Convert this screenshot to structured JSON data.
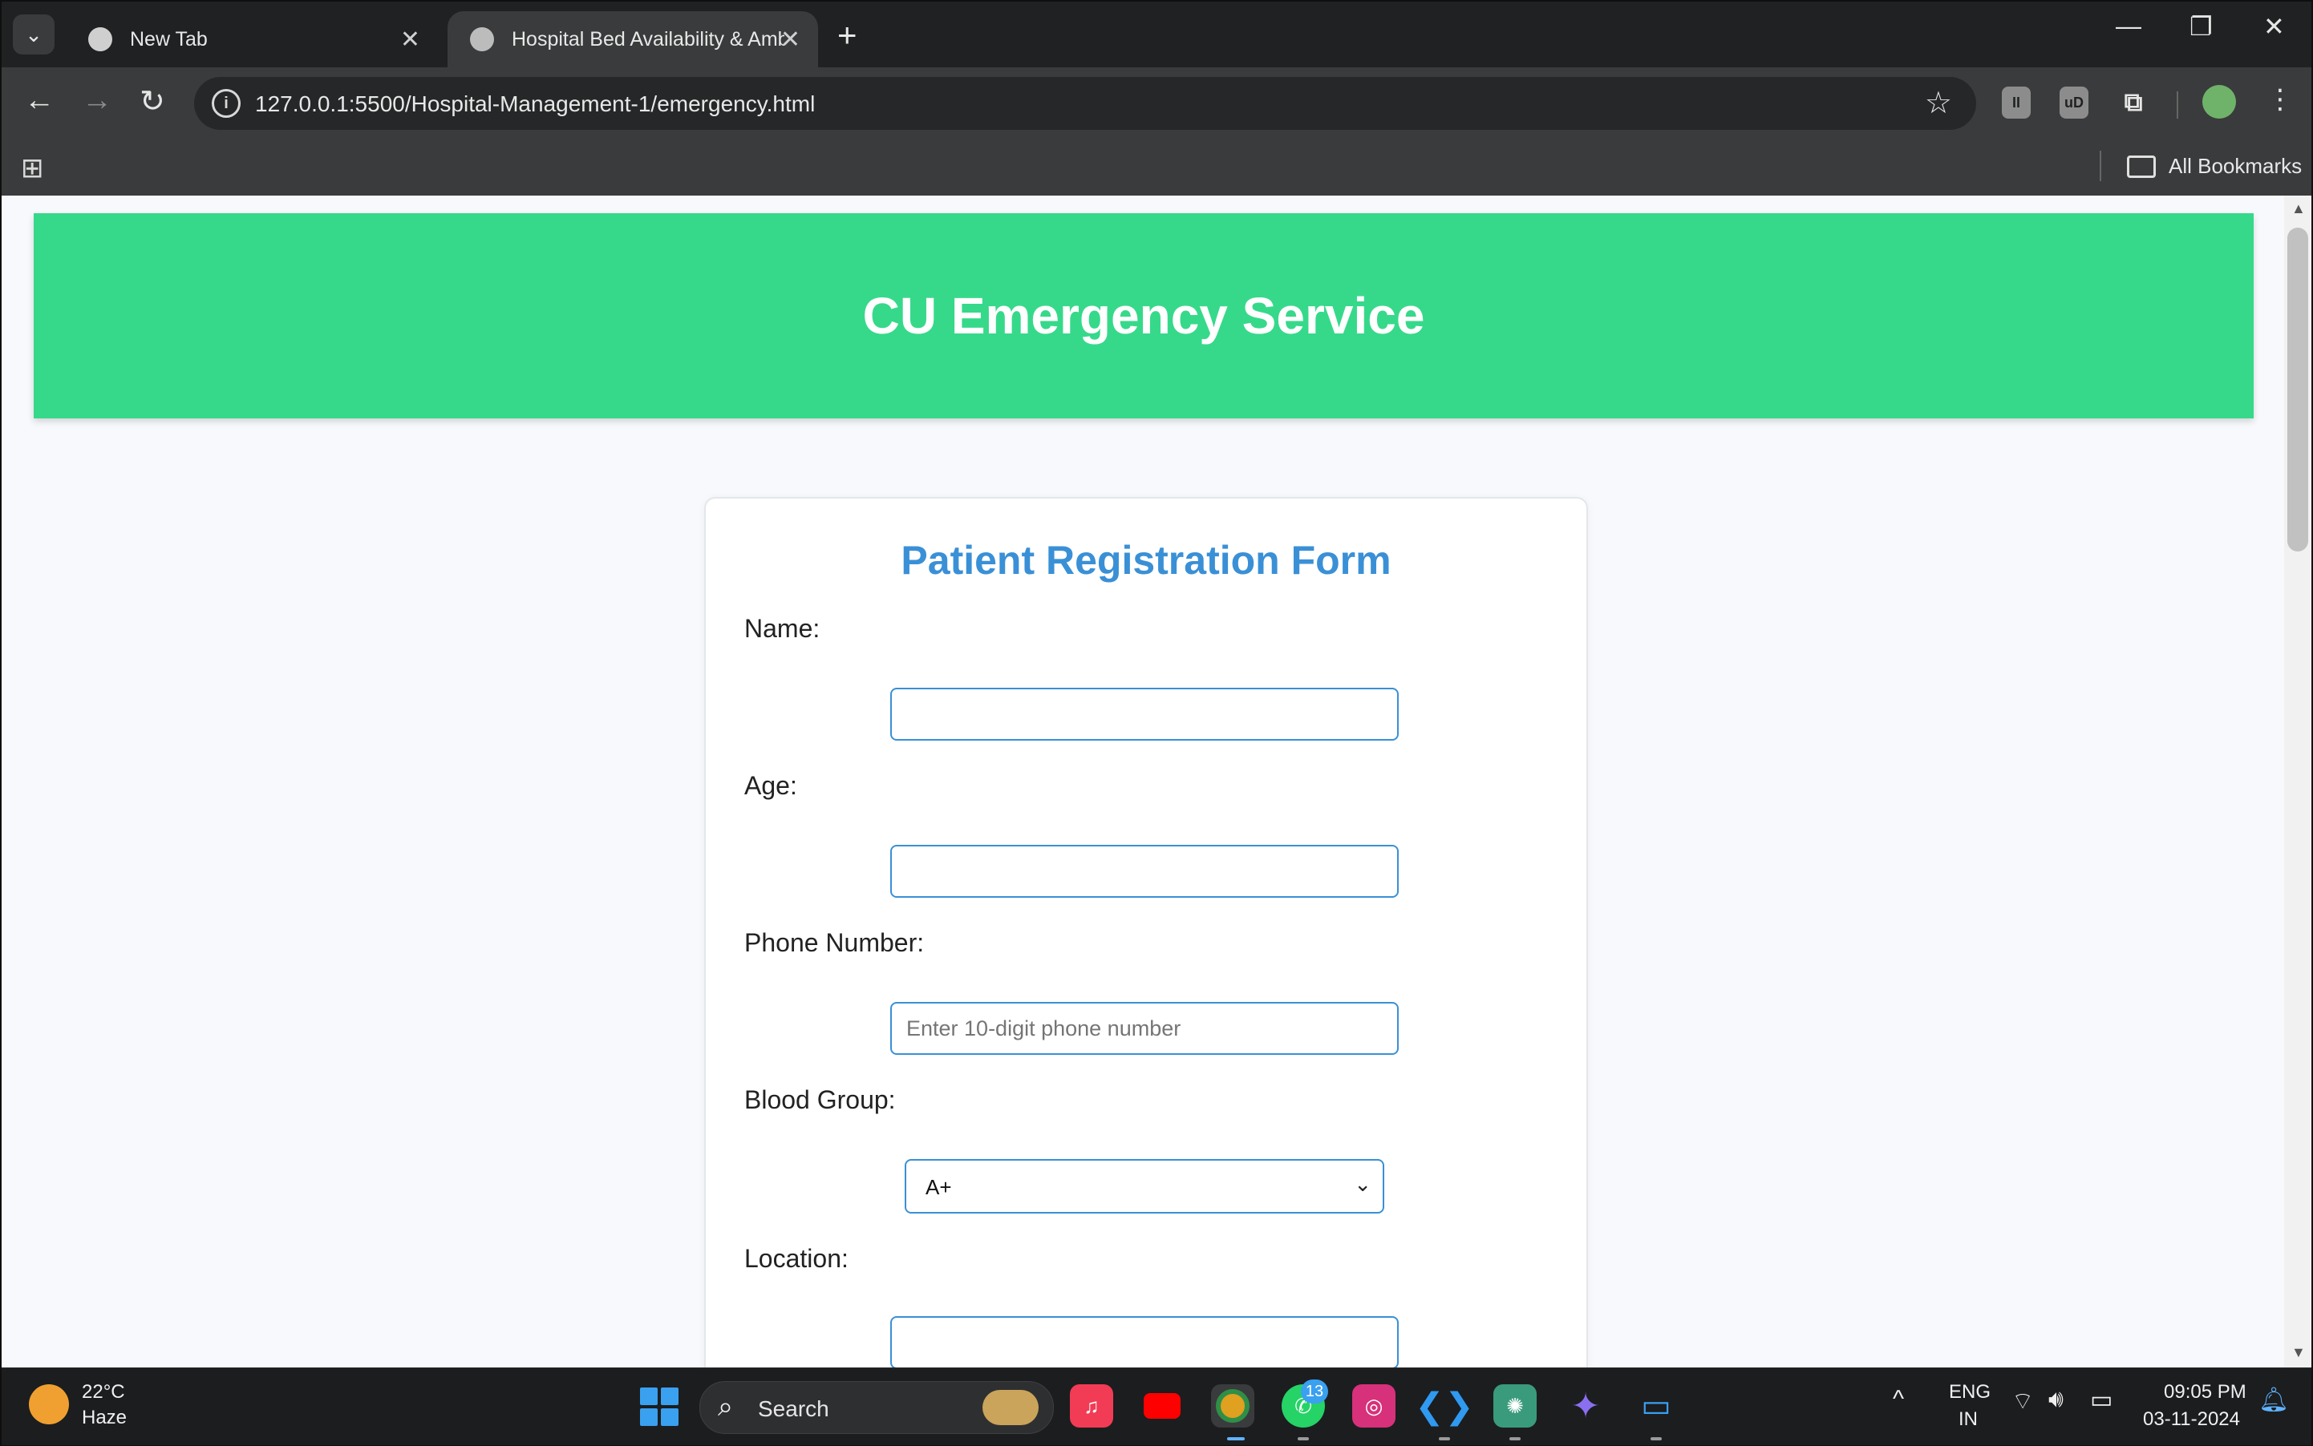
{
  "browser": {
    "tabs": [
      {
        "label": "New Tab",
        "active": false
      },
      {
        "label": "Hospital Bed Availability & Ambulance",
        "active": true
      }
    ],
    "url": "127.0.0.1:5500/Hospital-Management-1/emergency.html",
    "bookmarks_all": "All Bookmarks"
  },
  "page": {
    "header_title": "CU Emergency Service",
    "form_title": "Patient Registration Form",
    "fields": {
      "name_label": "Name:",
      "age_label": "Age:",
      "phone_label": "Phone Number:",
      "phone_placeholder": "Enter 10-digit phone number",
      "blood_label": "Blood Group:",
      "blood_selected": "A+",
      "location_label": "Location:"
    }
  },
  "taskbar": {
    "weather_temp": "22°C",
    "weather_condition": "Haze",
    "search_label": "Search",
    "whatsapp_badge": "13",
    "lang_primary": "ENG",
    "lang_region": "IN",
    "time": "09:05 PM",
    "date": "03-11-2024"
  },
  "colors": {
    "header_bg": "#36d98a",
    "form_title": "#3a90d6",
    "input_border": "#3a90d6"
  }
}
